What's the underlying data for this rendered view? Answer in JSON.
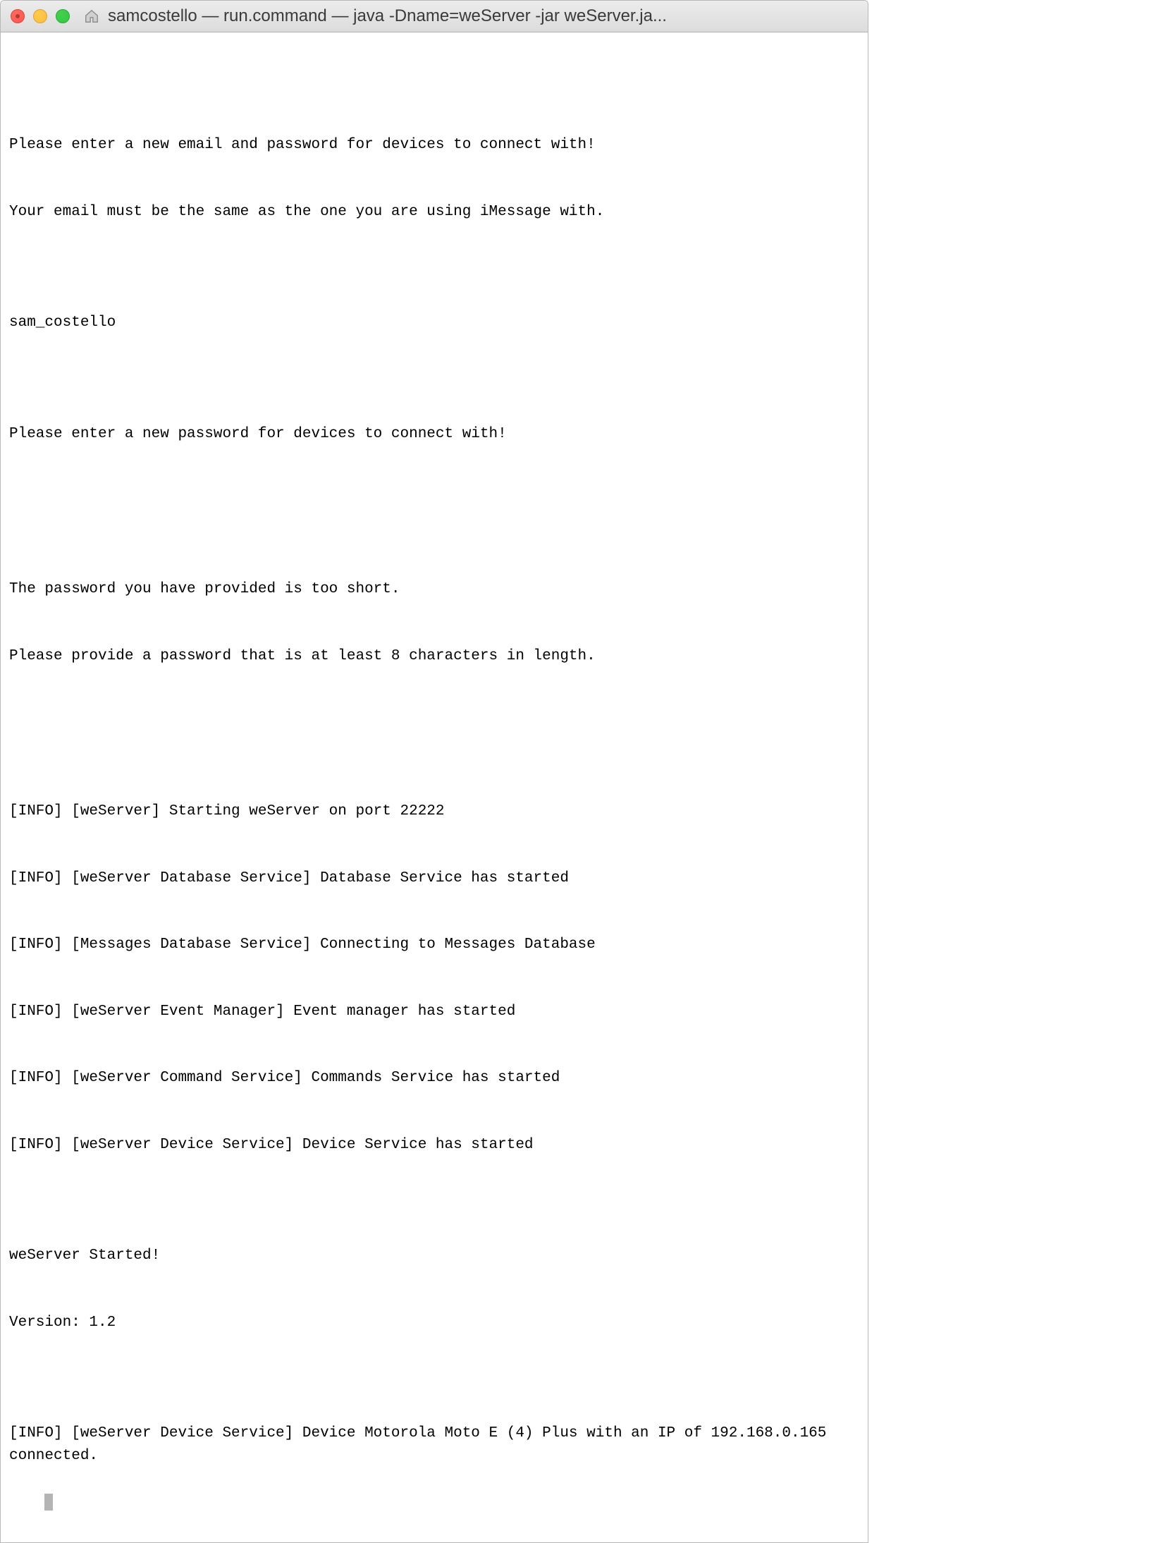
{
  "titlebar": {
    "title": "samcostello — run.command — java -Dname=weServer -jar weServer.ja..."
  },
  "terminal": {
    "lines": [
      "",
      "Please enter a new email and password for devices to connect with!",
      "Your email must be the same as the one you are using iMessage with.",
      "",
      "sam_costello",
      "",
      "Please enter a new password for devices to connect with!",
      "",
      "",
      "The password you have provided is too short.",
      "Please provide a password that is at least 8 characters in length.",
      "",
      "",
      "[INFO] [weServer] Starting weServer on port 22222",
      "[INFO] [weServer Database Service] Database Service has started",
      "[INFO] [Messages Database Service] Connecting to Messages Database",
      "[INFO] [weServer Event Manager] Event manager has started",
      "[INFO] [weServer Command Service] Commands Service has started",
      "[INFO] [weServer Device Service] Device Service has started",
      "",
      "weServer Started!",
      "Version: 1.2",
      "",
      "[INFO] [weServer Device Service] Device Motorola Moto E (4) Plus with an IP of 192.168.0.165 connected."
    ]
  }
}
